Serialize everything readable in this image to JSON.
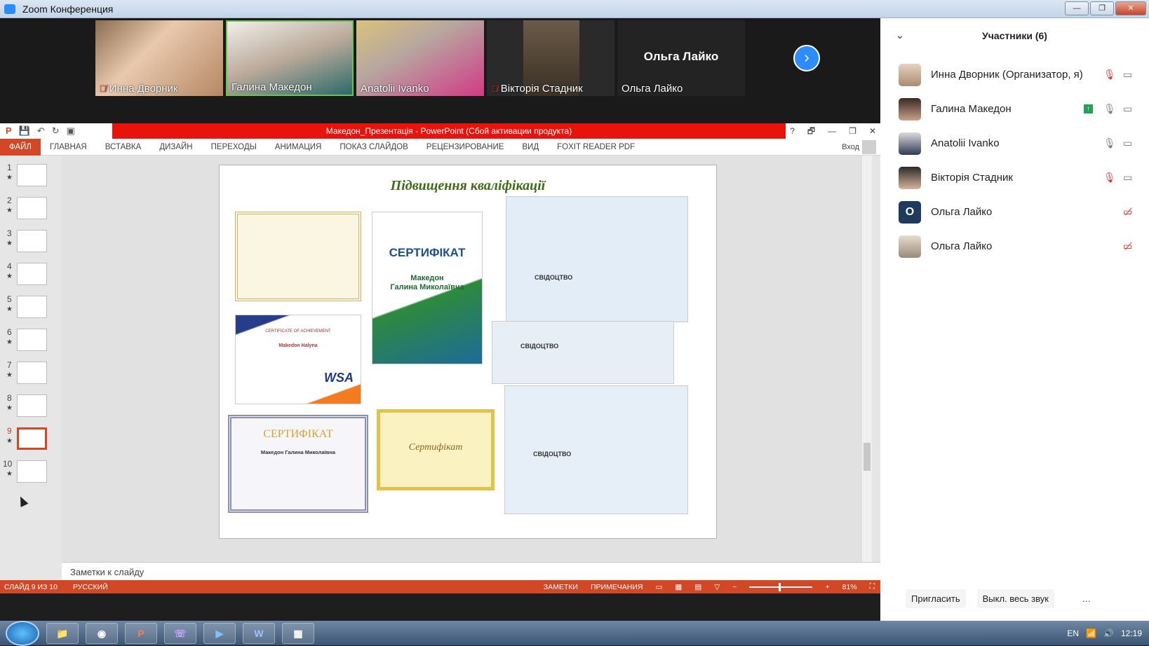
{
  "window": {
    "title": "Zoom Конференция",
    "btn_min": "—",
    "btn_max": "❐",
    "btn_close": "✕"
  },
  "gallery": {
    "tiles": [
      {
        "name": "Инна Дворник",
        "muted": true
      },
      {
        "name": "Галина Македон",
        "muted": false
      },
      {
        "name": "Anatolii Ivanko",
        "muted": false
      },
      {
        "name": "Вікторія Стадник",
        "muted": true
      },
      {
        "name": "Ольга Лайко",
        "muted": false,
        "big_name": "Ольга Лайко"
      }
    ],
    "next_label": "›"
  },
  "ppt": {
    "title": "Македон_Презентація - PowerPoint (Сбой активации продукта)",
    "help": "?",
    "ribbon_opts": "🗗",
    "minimize": "—",
    "restore": "❐",
    "close": "✕",
    "tabs": [
      "ФАЙЛ",
      "ГЛАВНАЯ",
      "ВСТАВКА",
      "ДИЗАЙН",
      "ПЕРЕХОДЫ",
      "АНИМАЦИЯ",
      "ПОКАЗ СЛАЙДОВ",
      "РЕЦЕНЗИРОВАНИЕ",
      "ВИД",
      "FOXIT READER PDF"
    ],
    "login": "Вход",
    "thumb_numbers": [
      "1",
      "2",
      "3",
      "4",
      "5",
      "6",
      "7",
      "8",
      "9",
      "10"
    ],
    "star": "★",
    "slide_title": "Підвищення кваліфікації",
    "cert": {
      "word": "СЕРТИФІКАТ",
      "name1": "Македон",
      "name2": "Галина Миколаївна"
    },
    "cert2": {
      "word": "СЕРТИФІКАТ",
      "name": "Македон Галина Миколаївна"
    },
    "cert3": {
      "word": "Сертифікат"
    },
    "achievement": {
      "title": "CERTIFICATE OF ACHIEVEMENT",
      "name": "Makedon Halyna",
      "logo": "WSA"
    },
    "svid": "СВІДОЦТВО",
    "notes_placeholder": "Заметки к слайду",
    "status": {
      "slide": "СЛАЙД 9 ИЗ 10",
      "lang": "РУССКИЙ",
      "notes": "ЗАМЕТКИ",
      "comments": "ПРИМЕЧАНИЯ",
      "zoom": "81%",
      "minus": "−",
      "plus": "+"
    }
  },
  "participants": {
    "header": "Участники (6)",
    "list": [
      {
        "name": "Инна Дворник (Организатор, я)",
        "letter": ""
      },
      {
        "name": "Галина Македон",
        "letter": ""
      },
      {
        "name": "Anatolii Ivanko",
        "letter": ""
      },
      {
        "name": "Вікторія Стадник",
        "letter": ""
      },
      {
        "name": "Ольга Лайко",
        "letter": "О"
      },
      {
        "name": "Ольга Лайко",
        "letter": ""
      }
    ],
    "invite": "Пригласить",
    "mute_all": "Выкл. весь звук",
    "more": "..."
  },
  "taskbar": {
    "apps": [
      "📁",
      "◉",
      "P",
      "☏",
      "▶",
      "W",
      "▦"
    ],
    "lang": "EN",
    "time": "12:19"
  },
  "colors": {
    "accent": "#d24726",
    "zoom_blue": "#2d8cff",
    "mute_red": "#e03030",
    "ppt_red": "#e8140c"
  }
}
